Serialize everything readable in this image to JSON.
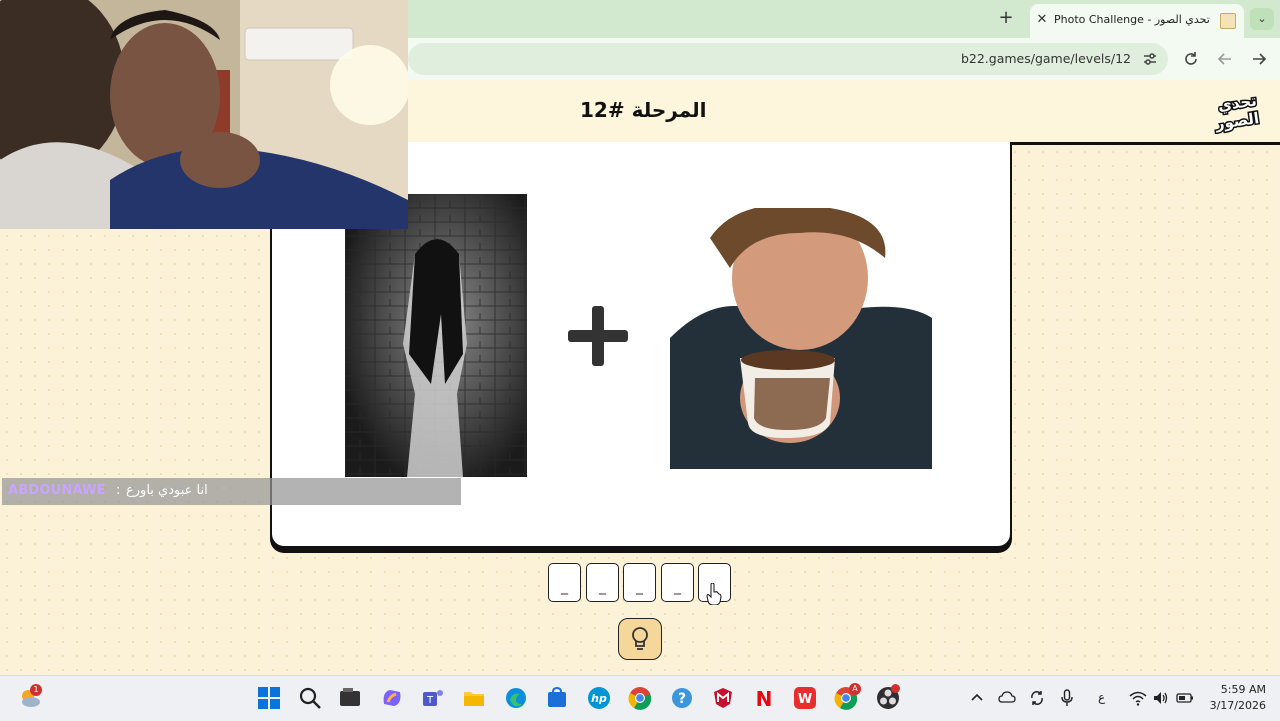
{
  "browser": {
    "tab_title": "Photo Challenge - تحدي الصور",
    "url": "b22.games/game/levels/12"
  },
  "game": {
    "level_title": "المرحلة #12",
    "logo_text": "تحدي الصور",
    "answer_slots": [
      "_",
      "_",
      "_",
      "_",
      "_"
    ]
  },
  "chat": {
    "username": "ABDOUNAWE",
    "separator": ":",
    "message": "انا عبودي باورع"
  },
  "taskbar": {
    "language": "ع",
    "time": "5:59 AM",
    "date": "3/17/2026",
    "weather_badge": "1"
  },
  "colors": {
    "tab_strip": "#d3e9cf",
    "page_background": "#fbf2d8",
    "hint_button": "#f6d79a",
    "chat_username": "#c9a5ff"
  }
}
